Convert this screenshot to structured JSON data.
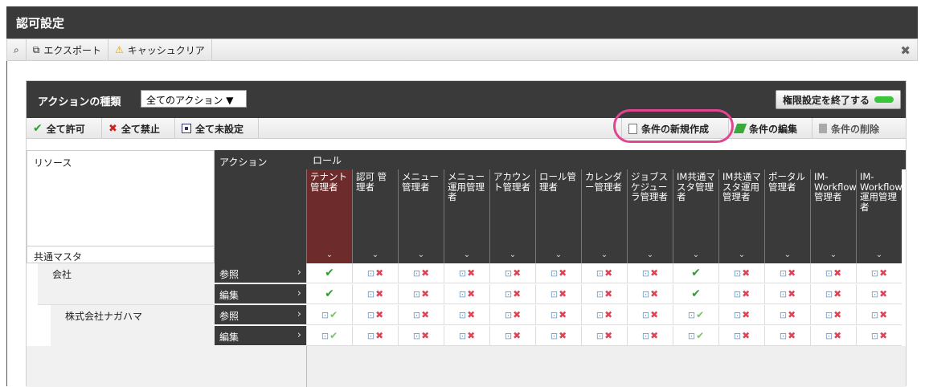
{
  "window": {
    "title": "認可設定"
  },
  "toolbar": {
    "export_label": "エクスポート",
    "cache_clear_label": "キャッシュクリア",
    "close_glyph": "✖"
  },
  "actionbar": {
    "label": "アクションの種類",
    "select_value": "全てのアクション ▼",
    "end_button_label": "権限設定を終了する"
  },
  "buttons": {
    "allow_all": "全て許可",
    "deny_all": "全て禁止",
    "unset_all": "全て未設定",
    "new_condition": "条件の新規作成",
    "edit_condition": "条件の編集",
    "delete_condition": "条件の削除"
  },
  "grid": {
    "resource_header": "リソース",
    "resource_group": "共通マスタ",
    "action_header": "アクション",
    "role_header": "ロール",
    "roles": [
      "テナント管理者",
      "認可 管理者",
      "メニュー管理者",
      "メニュー運用管理者",
      "アカウント管理者",
      "ロール管理者",
      "カレンダー管理者",
      "ジョブスケジューラ管理者",
      "IM共通マスタ管理者",
      "IM共通マスタ運用管理者",
      "ポータル管理者",
      "IM-Workflow 管理者",
      "IM-Workflow 運用管理者"
    ],
    "resources": [
      {
        "name": "会社",
        "actions": [
          {
            "label": "参照",
            "cells": [
              "allow",
              "deny",
              "deny",
              "deny",
              "deny",
              "deny",
              "deny",
              "deny",
              "allow",
              "deny",
              "deny",
              "deny",
              "deny"
            ]
          },
          {
            "label": "編集",
            "cells": [
              "allow",
              "deny",
              "deny",
              "deny",
              "deny",
              "deny",
              "deny",
              "deny",
              "allow",
              "deny",
              "deny",
              "deny",
              "deny"
            ]
          }
        ]
      },
      {
        "name": "株式会社ナガハマ",
        "actions": [
          {
            "label": "参照",
            "cells": [
              "allowsub",
              "deny",
              "deny",
              "deny",
              "deny",
              "deny",
              "deny",
              "deny",
              "allowsub",
              "deny",
              "deny",
              "deny",
              "deny"
            ]
          },
          {
            "label": "編集",
            "cells": [
              "allowsub",
              "deny",
              "deny",
              "deny",
              "deny",
              "deny",
              "deny",
              "deny",
              "allowsub",
              "deny",
              "deny",
              "deny",
              "deny"
            ]
          }
        ]
      }
    ]
  }
}
